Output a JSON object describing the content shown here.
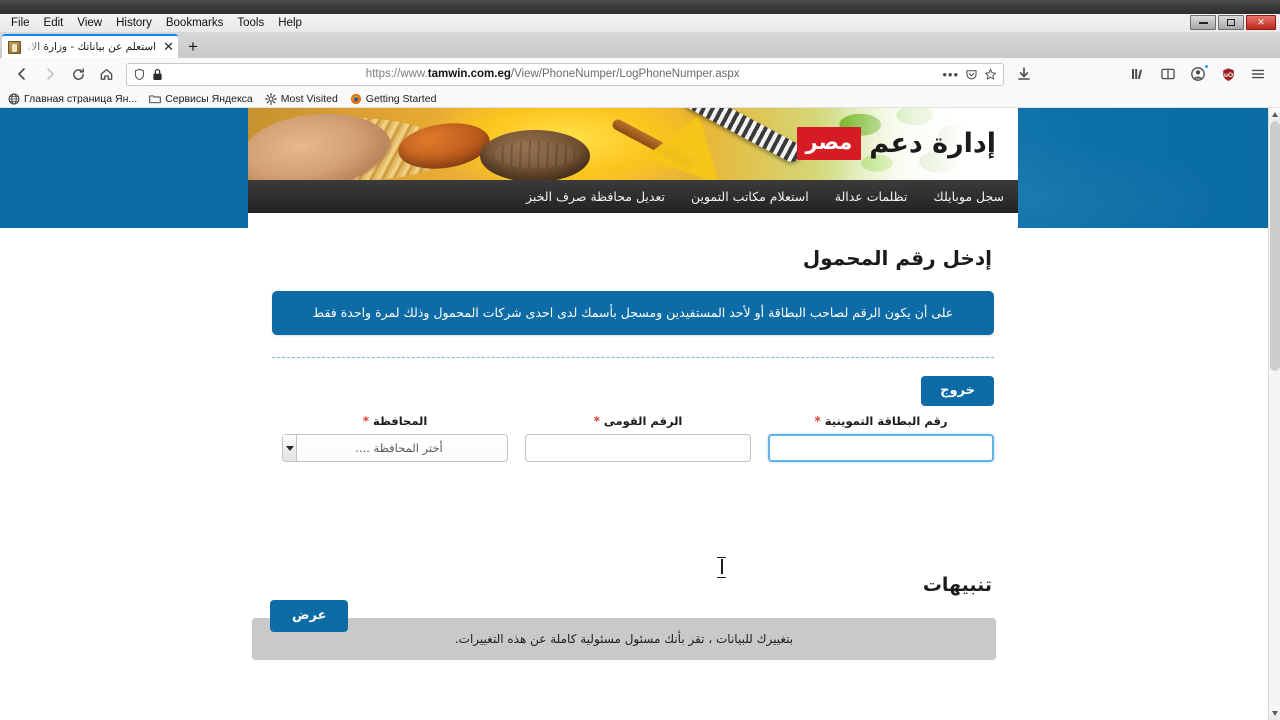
{
  "browser": {
    "menu": [
      "File",
      "Edit",
      "View",
      "History",
      "Bookmarks",
      "Tools",
      "Help"
    ],
    "window_controls": {
      "minimize": "minimize-button",
      "restore": "restore-button",
      "close": "close-button"
    },
    "tab": {
      "title": "استعلم عن بياناتك - وزارة الانتاج الح",
      "close_label": "✕",
      "newtab_label": "+"
    },
    "url": {
      "scheme": "https://www.",
      "domain": "tamwin.com.eg",
      "path": "/View/PhoneNumper/LogPhoneNumper.aspx",
      "full": "https://www.tamwin.com.eg/View/PhoneNumper/LogPhoneNumper.aspx"
    },
    "bookmarks": [
      {
        "label": "Главная страница Ян...",
        "icon": "globe-icon"
      },
      {
        "label": "Сервисы Яндекса",
        "icon": "folder-icon"
      },
      {
        "label": "Most Visited",
        "icon": "gear-icon"
      },
      {
        "label": "Getting Started",
        "icon": "firefox-icon"
      }
    ],
    "toolbar_icons": [
      "back-icon",
      "forward-icon",
      "reload-icon",
      "home-icon",
      "shield-icon",
      "lock-icon",
      "page-actions-icon",
      "pocket-icon",
      "bookmark-star-icon",
      "download-icon",
      "library-icon",
      "sidebar-icon",
      "account-icon",
      "ublock-icon",
      "menu-icon"
    ]
  },
  "site": {
    "logo": {
      "text": "إدارة دعم",
      "badge": "مصر",
      "badge_color": "#d51c24"
    },
    "nav": [
      {
        "label": "سجل موبايلك"
      },
      {
        "label": "تظلمات عدالة"
      },
      {
        "label": "استعلام مكاتب التموين"
      },
      {
        "label": "تعديل محافظة صرف الخبز"
      }
    ]
  },
  "page": {
    "title": "إدخل رقم المحمول",
    "info_banner": "على أن يكون الرقم لصاحب البطاقة أو لأحد المستفيدين ومسجل بأسمك لدى احدى شركات المحمول وذلك لمرة واحدة فقط",
    "exit_button": "خروج",
    "show_button": "عرض",
    "fields": [
      {
        "name": "ration-card-number",
        "label": "رقم البطاقة التموينية",
        "required": "*",
        "value": "",
        "type": "text",
        "focused": true
      },
      {
        "name": "national-id",
        "label": "الرقم القومى",
        "required": "*",
        "value": "",
        "type": "text",
        "focused": false
      },
      {
        "name": "governorate",
        "label": "المحافظة",
        "required": "*",
        "value": "أختر المحافظة ....",
        "type": "select",
        "focused": false
      }
    ],
    "alerts_heading": "تنبيهات",
    "alerts": [
      "بتغييرك للبيانات ، تقر بأنك مسئول مسئولية كاملة عن هذه التغييرات."
    ]
  },
  "colors": {
    "brand_blue": "#0d6ba6",
    "band_blue": "#0a6ca3",
    "nav_dark": "#2b2b2b",
    "logo_red": "#d51c24",
    "required_red": "#e03a2f",
    "alert_gray": "#c9c9c9"
  }
}
